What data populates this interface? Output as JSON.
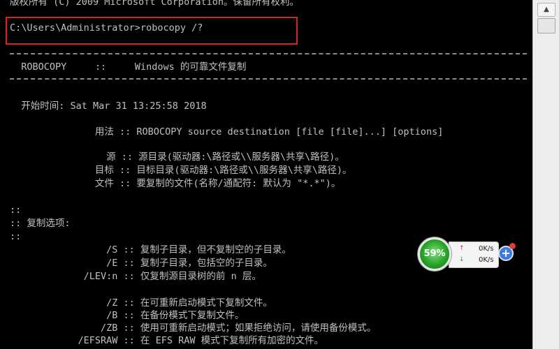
{
  "console": {
    "copyright": "版权所有 (C) 2009 Microsoft Corporation。保留所有权利。",
    "prompt": "C:\\Users\\Administrator>robocopy /?",
    "header": "  ROBOCOPY     ::     Windows 的可靠文件复制",
    "start_time": "  开始时间: Sat Mar 31 13:25:58 2018",
    "usage": "               用法 :: ROBOCOPY source destination [file [file]...] [options]",
    "source": "                 源 :: 源目录(驱动器:\\路径或\\\\服务器\\共享\\路径)。",
    "target": "               目标 :: 目标目录(驱动器:\\路径或\\\\服务器\\共享\\路径)。",
    "files": "               文件 :: 要复制的文件(名称/通配符: 默认为 \"*.*\")。",
    "sep1": "::",
    "copy_options": ":: 复制选项:",
    "sep2": "::",
    "opt_s": "                 /S :: 复制子目录，但不复制空的子目录。",
    "opt_e": "                 /E :: 复制子目录，包括空的子目录。",
    "opt_lev": "             /LEV:n :: 仅复制源目录树的前 n 层。",
    "opt_z": "                 /Z :: 在可重新启动模式下复制文件。",
    "opt_b": "                 /B :: 在备份模式下复制文件。",
    "opt_zb": "                /ZB :: 使用可重新启动模式；如果拒绝访问，请使用备份模式。",
    "opt_efsraw": "            /EFSRAW :: 在 EFS RAW 模式下复制所有加密的文件。"
  },
  "speed_widget": {
    "percent": "59%",
    "upload": "0K/s",
    "download": "0K/s",
    "up_arrow": "↑",
    "down_arrow": "↓",
    "plus": "+"
  },
  "scrollbar": {
    "up_glyph": "▲"
  },
  "colors": {
    "console_bg": "#000000",
    "console_text": "#c0c0c0",
    "highlight_box": "#d9261c",
    "gauge_green": "#27a327"
  }
}
